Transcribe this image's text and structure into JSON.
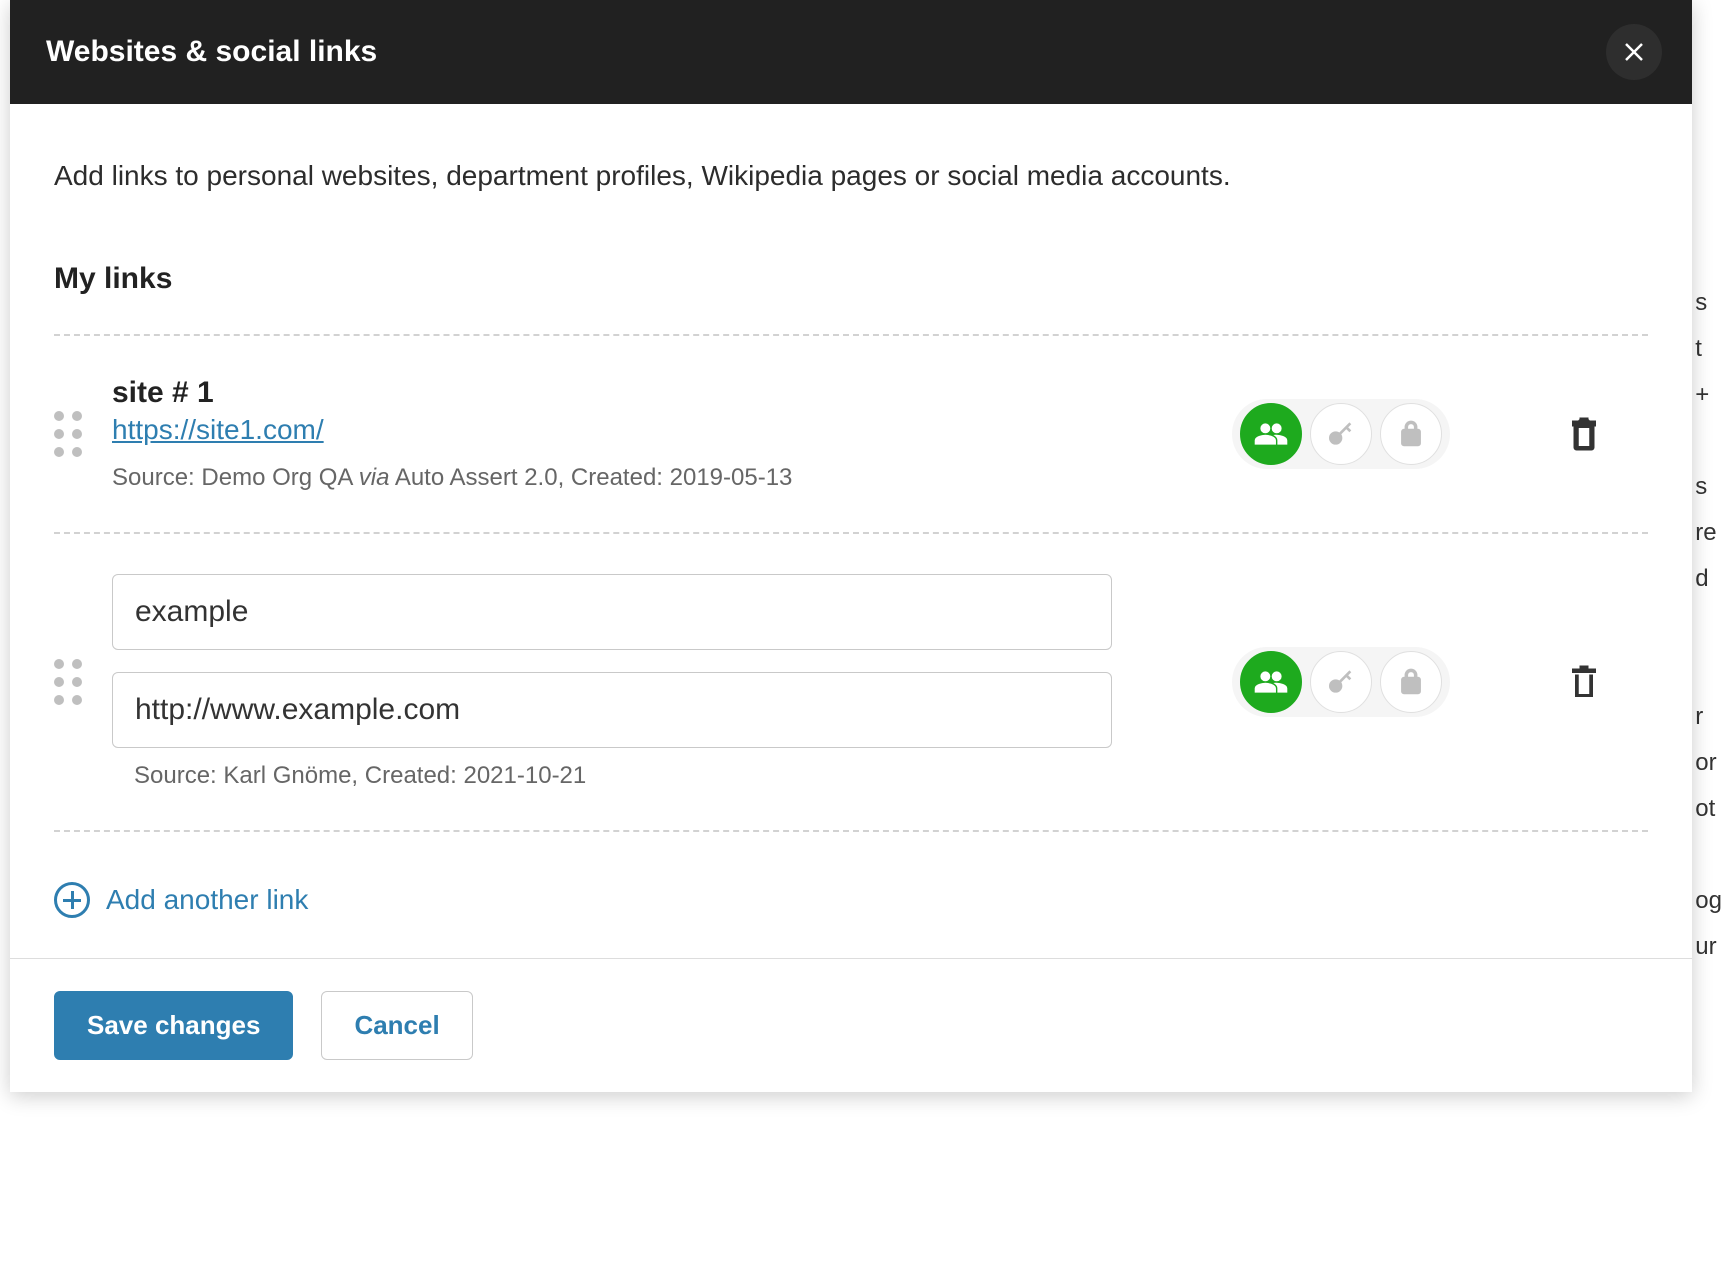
{
  "modal": {
    "title": "Websites & social links",
    "description": "Add links to personal websites, department profiles, Wikipedia pages or social media accounts.",
    "section_title": "My links",
    "add_another": "Add another link",
    "save_label": "Save changes",
    "cancel_label": "Cancel"
  },
  "links": [
    {
      "title": "site # 1",
      "url": "https://site1.com/",
      "source_prefix": "Source: ",
      "source_org": "Demo Org QA ",
      "via_word": "via",
      "via_rest": " Auto Assert 2.0, Created: 2019-05-13",
      "visibility": "everyone"
    },
    {
      "title_value": "example",
      "url_value": "http://www.example.com",
      "source_full": "Source: Karl Gnöme, Created: 2021-10-21",
      "visibility": "everyone"
    }
  ]
}
